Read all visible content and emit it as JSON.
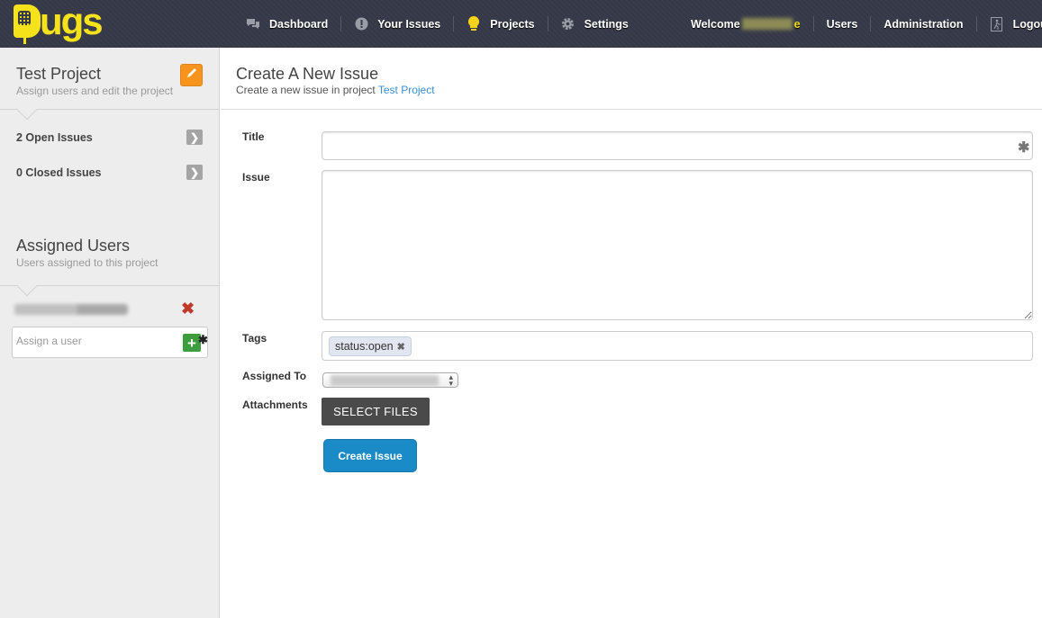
{
  "brand": {
    "name": "Bugs",
    "logo_icon": "fly-swatter-icon",
    "accent": "#f6e21b"
  },
  "nav": {
    "left": [
      {
        "label": "Dashboard",
        "icon": "chat-bubbles-icon"
      },
      {
        "label": "Your Issues",
        "icon": "exclamation-circle-icon"
      },
      {
        "label": "Projects",
        "icon": "lightbulb-icon"
      },
      {
        "label": "Settings",
        "icon": "gear-icon"
      }
    ],
    "welcome": {
      "prefix": "Welcome",
      "name_suffix": "e"
    },
    "right": [
      {
        "label": "Users"
      },
      {
        "label": "Administration"
      },
      {
        "label": "Logout",
        "icon": "exit-door-icon"
      }
    ]
  },
  "sidebar": {
    "project": {
      "title": "Test Project",
      "subtitle": "Assign users and edit the project",
      "edit_icon": "pencil-icon"
    },
    "links": [
      {
        "label": "2 Open Issues"
      },
      {
        "label": "0 Closed Issues"
      }
    ],
    "assigned": {
      "title": "Assigned Users",
      "subtitle": "Users assigned to this project",
      "users": [
        {
          "name": "[redacted]",
          "remove_icon": "x-icon"
        }
      ],
      "assign_placeholder": "Assign a user"
    }
  },
  "main": {
    "title": "Create A New Issue",
    "subtitle_prefix": "Create a new issue in project",
    "subtitle_link": "Test Project",
    "form": {
      "title_label": "Title",
      "title_value": "",
      "issue_label": "Issue",
      "issue_value": "",
      "tags_label": "Tags",
      "tags": [
        "status:open"
      ],
      "assigned_label": "Assigned To",
      "assigned_value": "[redacted]",
      "attachments_label": "Attachments",
      "select_files": "SELECT FILES",
      "submit": "Create Issue"
    }
  },
  "colors": {
    "topbar": "#363a48",
    "edit": "#f7941d",
    "primary": "#1a8bc6",
    "remove": "#c0392b",
    "add": "#3d9c3d",
    "link": "#3a8fd1"
  }
}
